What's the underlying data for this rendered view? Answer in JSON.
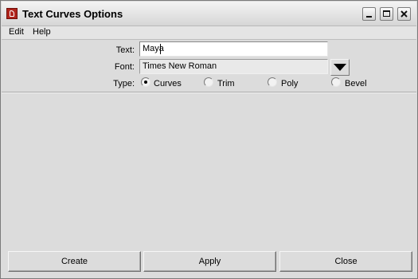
{
  "window": {
    "title": "Text Curves Options",
    "controls": {
      "minimize_icon": "minimize-icon",
      "maximize_icon": "maximize-icon",
      "close_icon": "close-icon"
    }
  },
  "menubar": {
    "items": [
      {
        "label": "Edit"
      },
      {
        "label": "Help"
      }
    ]
  },
  "form": {
    "text": {
      "label": "Text:",
      "value": "Maya"
    },
    "font": {
      "label": "Font:",
      "value": "Times New Roman",
      "dropdown_icon": "triangle-down-icon"
    },
    "type": {
      "label": "Type:",
      "selected": "Curves",
      "options": [
        {
          "label": "Curves",
          "checked": true
        },
        {
          "label": "Trim",
          "checked": false
        },
        {
          "label": "Poly",
          "checked": false
        },
        {
          "label": "Bevel",
          "checked": false
        }
      ]
    }
  },
  "buttons": {
    "create": "Create",
    "apply": "Apply",
    "close": "Close"
  },
  "colors": {
    "app_icon": "#b0241c",
    "background": "#dcdcdc"
  }
}
